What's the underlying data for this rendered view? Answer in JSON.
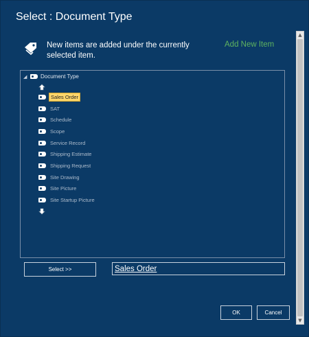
{
  "window": {
    "title": "Select : Document Type"
  },
  "info": {
    "icon": "tag-icon",
    "text": "New items are added under the currently selected item.",
    "add_new_label": "Add New Item",
    "add_new_color": "#5fb35f"
  },
  "tree": {
    "root_label": "Document Type",
    "items": [
      {
        "label": "Sales Order",
        "selected": true
      },
      {
        "label": "SAT"
      },
      {
        "label": "Schedule"
      },
      {
        "label": "Scope"
      },
      {
        "label": "Service Record"
      },
      {
        "label": "Shipping Estimate"
      },
      {
        "label": "Shipping Request"
      },
      {
        "label": "Site Drawing"
      },
      {
        "label": "Site Picture"
      },
      {
        "label": "Site Startup Picture"
      }
    ]
  },
  "actions": {
    "select_label": "Select >>",
    "selected_value": "Sales Order",
    "ok_label": "OK",
    "cancel_label": "Cancel"
  },
  "colors": {
    "background": "#0b3a66",
    "selection_highlight": "#ffd66b"
  }
}
